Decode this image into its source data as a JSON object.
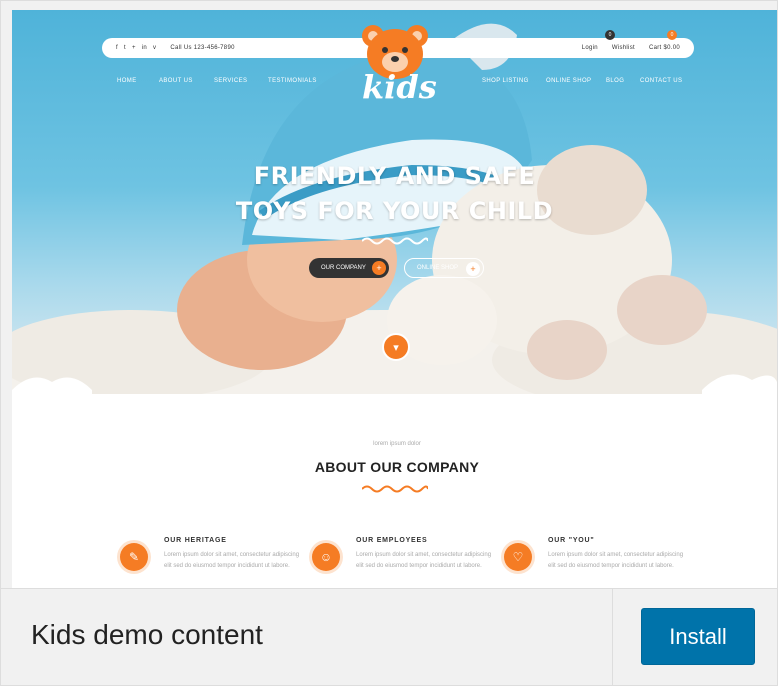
{
  "topbar": {
    "social_icons": [
      "f",
      "t",
      "+",
      "in",
      "v"
    ],
    "phone": "Call Us 123-456-7890",
    "login": "Login",
    "wishlist": "Wishlist",
    "cart": "Cart $0.00",
    "wishlist_count": "0",
    "cart_count": "0"
  },
  "nav": {
    "left": [
      "Home",
      "About Us",
      "Services",
      "Testimonials"
    ],
    "right": [
      "Shop Listing",
      "Online Shop",
      "Blog",
      "Contact Us"
    ]
  },
  "logo": {
    "text": "kids"
  },
  "hero": {
    "line1": "FRIENDLY AND SAFE",
    "line2": "TOYS FOR YOUR CHILD",
    "button_primary": "Our Company",
    "button_secondary": "Online Shop",
    "down_arrow": "▾"
  },
  "about": {
    "subtitle": "lorem ipsum dolor",
    "title": "ABOUT OUR COMPANY"
  },
  "features": [
    {
      "title": "Our Heritage",
      "text": "Lorem ipsum dolor sit amet, consectetur adipiscing elit sed do eiusmod tempor incididunt ut labore.",
      "icon": "✎"
    },
    {
      "title": "Our Employees",
      "text": "Lorem ipsum dolor sit amet, consectetur adipiscing elit sed do eiusmod tempor incididunt ut labore.",
      "icon": "☺"
    },
    {
      "title": "Our \"You\"",
      "text": "Lorem ipsum dolor sit amet, consectetur adipiscing elit sed do eiusmod tempor incididunt ut labore.",
      "icon": "♡"
    }
  ],
  "footer": {
    "demo_name": "Kids demo content",
    "install_label": "Install"
  },
  "colors": {
    "accent": "#f57c24",
    "install_button": "#0073aa",
    "sky": "#4fb3d9"
  }
}
